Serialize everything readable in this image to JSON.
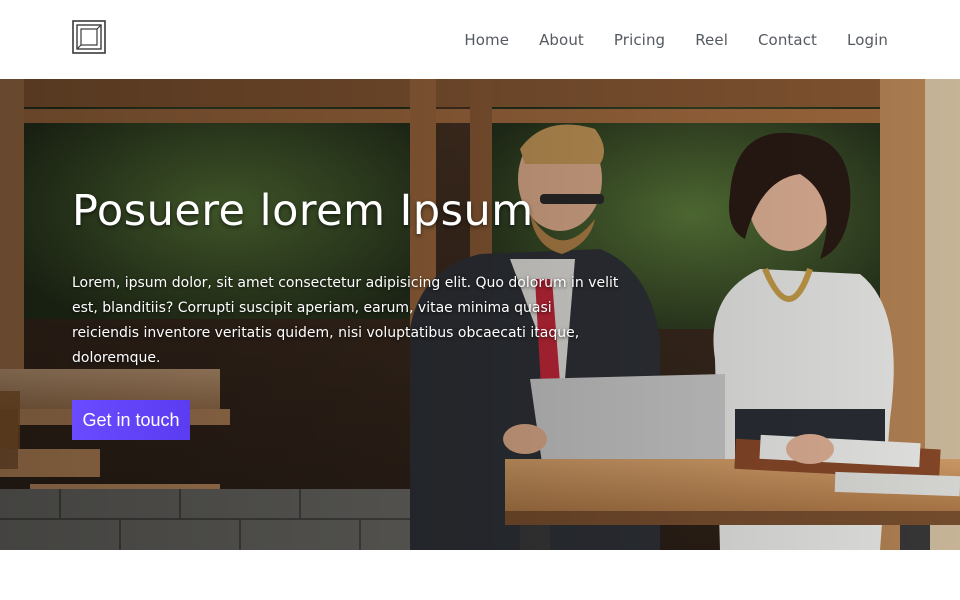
{
  "nav": {
    "logo_icon": "square-frame-logo-icon",
    "links": [
      "Home",
      "About",
      "Pricing",
      "Reel",
      "Contact",
      "Login"
    ]
  },
  "hero": {
    "title": "Posuere lorem Ipsum",
    "text": "Lorem, ipsum dolor, sit amet consectetur adipisicing elit. Quo dolorum in velit est, blanditiis? Corrupti suscipit aperiam, earum, vitae minima quasi reiciendis inventore veritatis quidem, nisi voluptatibus obcaecati itaque, doloremque.",
    "cta_label": "Get in touch",
    "background_image": "photo-two-people-working-at-laptop-cafe"
  },
  "colors": {
    "nav_text": "#555a61",
    "cta_start": "#6a4bff",
    "cta_end": "#5b3cf0",
    "hero_text": "#ffffff"
  }
}
